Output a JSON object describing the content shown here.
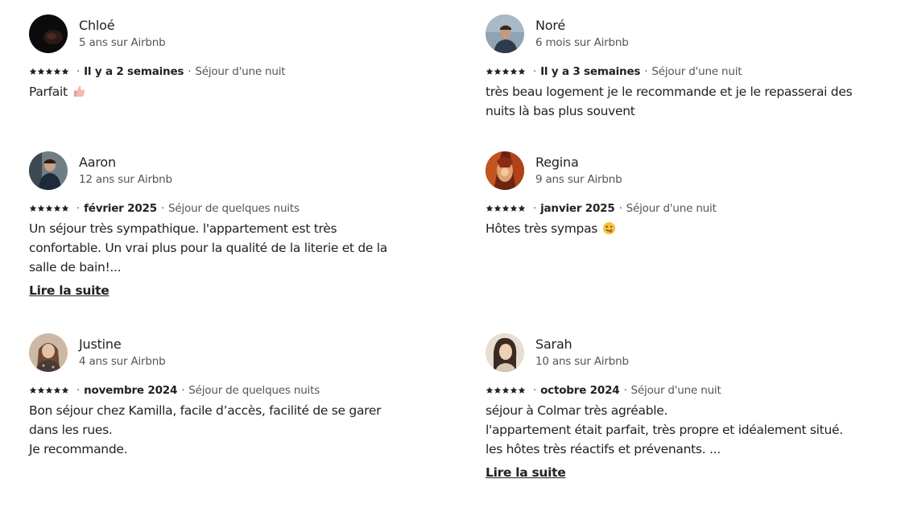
{
  "reviews": [
    {
      "name": "Chloé",
      "tenure": "5 ans sur Airbnb",
      "rating": 5,
      "date": "Il y a 2 semaines",
      "stay": "Séjour d'une nuit",
      "lines": [
        "Parfait"
      ],
      "emoji": "thumbs-up-emoji"
    },
    {
      "name": "Noré",
      "tenure": "6 mois sur Airbnb",
      "rating": 5,
      "date": "Il y a 3 semaines",
      "stay": "Séjour d'une nuit",
      "lines": [
        "très beau logement je le recommande et je le repasserai des nuits là bas plus souvent"
      ]
    },
    {
      "name": "Aaron",
      "tenure": "12 ans sur Airbnb",
      "rating": 5,
      "date": "février 2025",
      "stay": "Séjour de quelques nuits",
      "lines": [
        "Un séjour très sympathique. l'appartement est très confortable. Un vrai plus pour la qualité de la literie et de la salle de bain!..."
      ],
      "read_more": "Lire la suite"
    },
    {
      "name": "Regina",
      "tenure": "9 ans sur Airbnb",
      "rating": 5,
      "date": "janvier 2025",
      "stay": "Séjour d'une nuit",
      "lines": [
        "Hôtes très sympas"
      ],
      "emoji": "silly-face-emoji"
    },
    {
      "name": "Justine",
      "tenure": "4 ans sur Airbnb",
      "rating": 5,
      "date": "novembre 2024",
      "stay": "Séjour de quelques nuits",
      "lines": [
        "Bon séjour chez Kamilla, facile d’accès, facilité de se garer dans les rues.",
        "Je recommande."
      ]
    },
    {
      "name": "Sarah",
      "tenure": "10 ans sur Airbnb",
      "rating": 5,
      "date": "octobre 2024",
      "stay": "Séjour d'une nuit",
      "lines": [
        "séjour à Colmar très agréable.",
        "l'appartement était parfait, très propre et idéalement situé.",
        "les hôtes très réactifs et prévenants. ..."
      ],
      "read_more": "Lire la suite"
    }
  ],
  "colors": {
    "text": "#222222",
    "muted": "#555555"
  }
}
